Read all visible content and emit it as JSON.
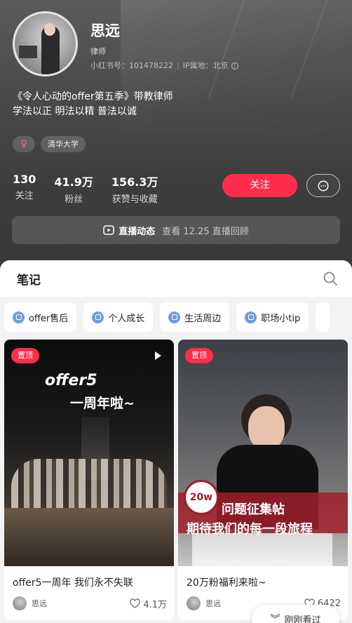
{
  "profile": {
    "name": "思远",
    "role": "律师",
    "id_label": "小红书号：101478222",
    "ip_label": "IP属地：北京",
    "bio_line1": "《令人心动的offer第五季》带教律师",
    "bio_line2": "学法以正 明法以精 普法以诚",
    "gender_symbol": "♀",
    "tag_school": "清华大学",
    "stats": [
      {
        "num": "130",
        "label": "关注"
      },
      {
        "num": "41.9万",
        "label": "粉丝"
      },
      {
        "num": "156.3万",
        "label": "获赞与收藏"
      }
    ],
    "follow_label": "关注",
    "live_title": "直播动态",
    "live_sub": "查看 12.25 直播回顾"
  },
  "notes": {
    "title": "笔记",
    "chips": [
      "offer售后",
      "个人成长",
      "生活周边",
      "职场小tip"
    ],
    "cards": [
      {
        "pin": "置顶",
        "cover_line1": "offer5",
        "cover_line2": "一周年啦~",
        "title": "offer5一周年 我们永不失联",
        "author": "思远",
        "likes": "4.1万"
      },
      {
        "pin": "置顶",
        "badge": "20w",
        "cover_line1": "问题征集帖",
        "cover_line2": "期待我们的每一段旅程",
        "title": "20万粉福利来啦~",
        "author": "思远",
        "likes": "6422"
      }
    ]
  },
  "recent_button": "刚刚看过",
  "colors": {
    "accent": "#ff2d4b",
    "chip_icon": "#6e9ce4"
  }
}
